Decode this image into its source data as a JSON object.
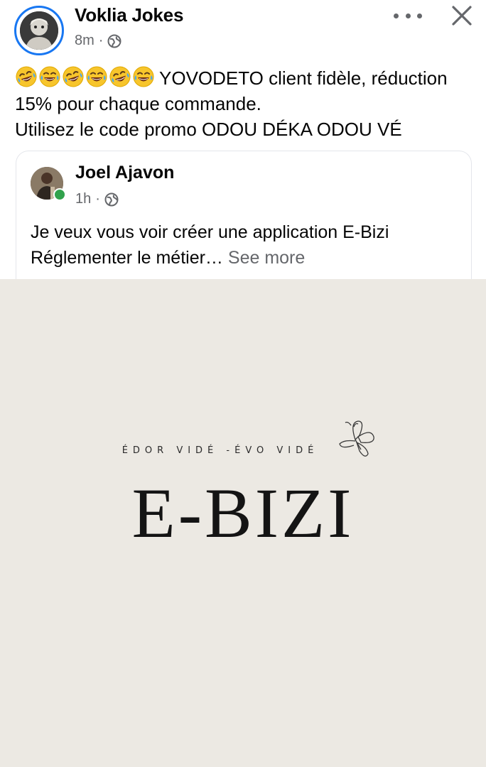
{
  "post": {
    "author": "Voklia Jokes",
    "time": "8m",
    "separator": "·",
    "privacy_icon": "globe-icon",
    "emoji_icon": "rolling-laughing-emoji-icon",
    "emoji_count": 6,
    "text_line1": "YOVODETO client fidèle, réduction",
    "text_line2": "15% pour chaque commande.",
    "text_line3": "Utilisez le code promo ODOU DÉKA ODOU VÉ"
  },
  "shared": {
    "author": "Joel Ajavon",
    "time": "1h",
    "separator": "·",
    "online": true,
    "text_line1": "Je veux vous voir créer une application E-Bizi",
    "text_line2": "Réglementer le métier…",
    "see_more": "See more"
  },
  "image": {
    "tagline": "ÉDOR VIDÉ -ÉVO VIDÉ",
    "brand": "E-BIZI",
    "background": "#ece9e3"
  },
  "colors": {
    "accent": "#1877f2",
    "meta": "#65676b",
    "online": "#31a24c"
  }
}
